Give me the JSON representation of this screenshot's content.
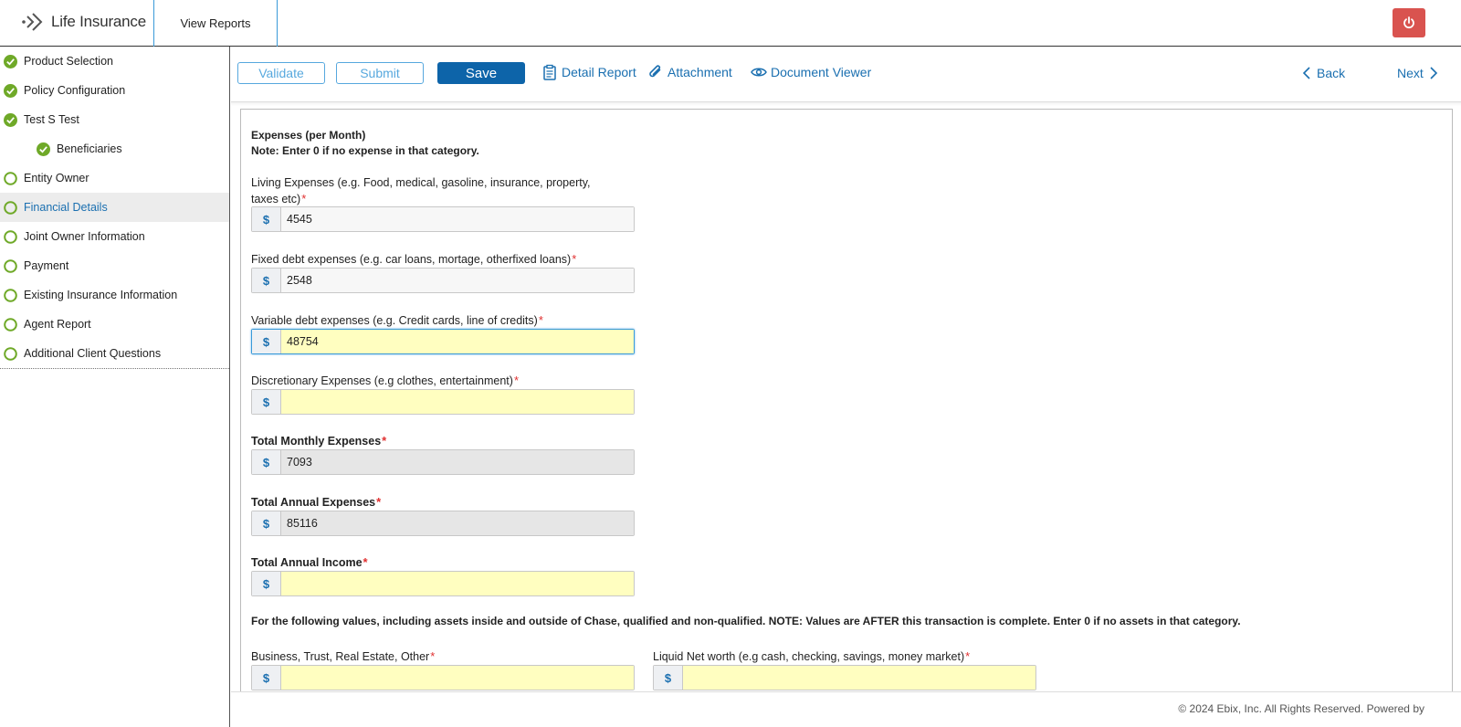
{
  "header": {
    "app_title": "Life Insurance",
    "tab_view_reports": "View Reports",
    "power_icon": "power-icon"
  },
  "sidebar": {
    "items": [
      {
        "label": "Product Selection",
        "status": "complete"
      },
      {
        "label": "Policy Configuration",
        "status": "complete"
      },
      {
        "label": "Test S Test",
        "status": "complete"
      },
      {
        "label": "Beneficiaries",
        "status": "complete"
      },
      {
        "label": "Entity Owner",
        "status": "incomplete"
      },
      {
        "label": "Financial Details",
        "status": "incomplete",
        "active": true
      },
      {
        "label": "Joint Owner Information",
        "status": "incomplete"
      },
      {
        "label": "Payment",
        "status": "incomplete"
      },
      {
        "label": "Existing Insurance Information",
        "status": "incomplete"
      },
      {
        "label": "Agent Report",
        "status": "incomplete"
      },
      {
        "label": "Additional Client Questions",
        "status": "incomplete"
      }
    ],
    "colors": {
      "complete": "#6fa928",
      "incomplete": "#6fa928",
      "active_text": "#1a6fb0"
    }
  },
  "toolbar": {
    "validate_label": "Validate",
    "submit_label": "Submit",
    "save_label": "Save",
    "detail_report_label": "Detail Report",
    "attachment_label": "Attachment",
    "document_viewer_label": "Document Viewer",
    "back_label": "Back",
    "next_label": "Next"
  },
  "form": {
    "section_title": "Expenses (per Month)",
    "section_note": "Note: Enter 0 if no expense in that category.",
    "currency_symbol": "$",
    "living_expenses": {
      "label": "Living Expenses (e.g. Food, medical, gasoline, insurance, property, taxes etc)",
      "value": "4545"
    },
    "fixed_debt": {
      "label": "Fixed debt expenses (e.g. car loans, mortage, otherfixed loans)",
      "value": "2548"
    },
    "variable_debt": {
      "label": "Variable debt expenses (e.g. Credit cards, line of credits)",
      "value": "48754"
    },
    "discretionary": {
      "label": "Discretionary Expenses (e.g clothes, entertainment)",
      "value": ""
    },
    "total_monthly": {
      "label": "Total Monthly Expenses",
      "value": "7093"
    },
    "total_annual_expenses": {
      "label": "Total Annual Expenses",
      "value": "85116"
    },
    "total_annual_income": {
      "label": "Total Annual Income",
      "value": ""
    },
    "assets_note": "For the following values, including assets inside and outside of Chase, qualified and non-qualified. NOTE: Values are AFTER this transaction is complete. Enter 0 if no assets in that category.",
    "business_trust": {
      "label": "Business, Trust, Real Estate, Other",
      "value": ""
    },
    "liquid_net_worth": {
      "label": "Liquid Net worth (e.g cash, checking, savings, money market)",
      "value": ""
    },
    "required_marker": "*"
  },
  "footer": {
    "text": "© 2024 Ebix, Inc. All Rights Reserved. Powered by"
  },
  "colors": {
    "primary": "#0d64a9",
    "link": "#1a6fb0",
    "danger": "#d9534f",
    "required": "#e03030",
    "input_yellow": "#fffec0",
    "input_gray": "#e6e6e6"
  }
}
